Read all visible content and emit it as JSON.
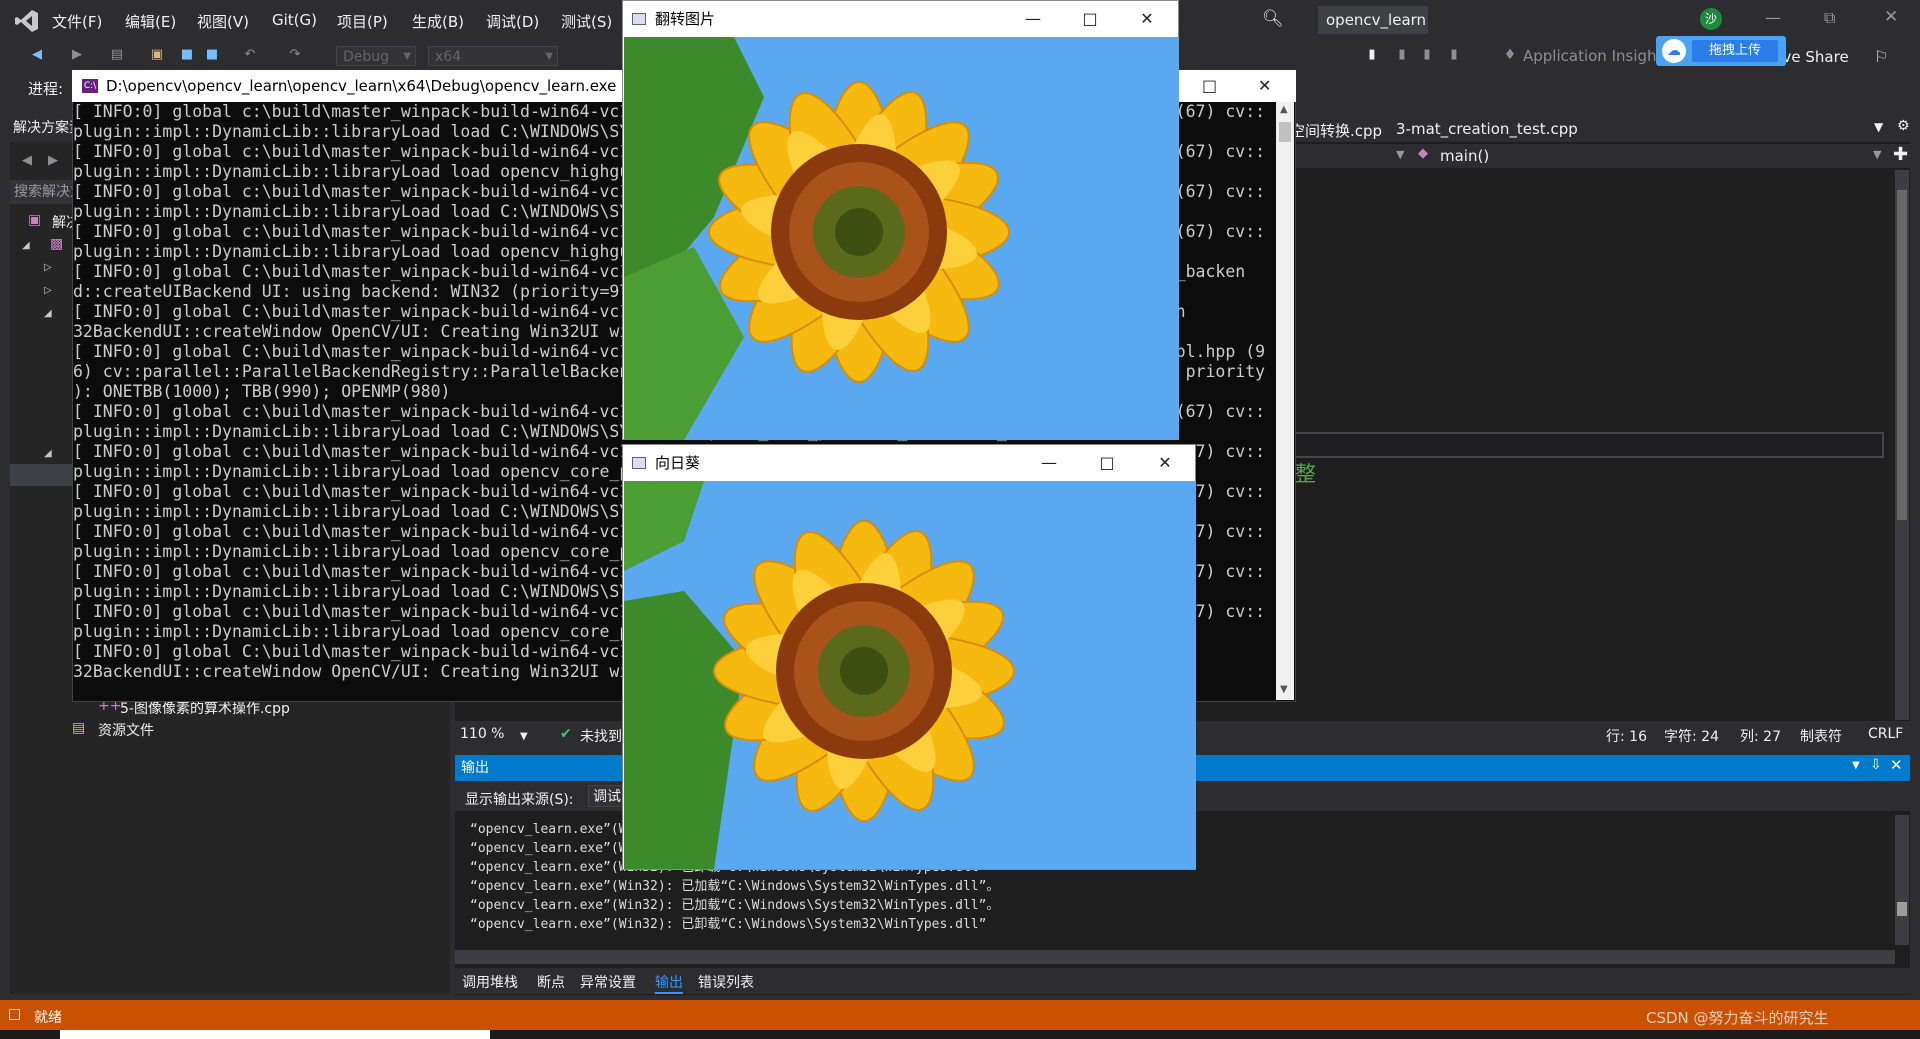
{
  "menu": {
    "items": [
      "文件(F)",
      "编辑(E)",
      "视图(V)",
      "Git(G)",
      "项目(P)",
      "生成(B)",
      "调试(D)",
      "测试(S)"
    ],
    "project_name": "opencv_learn",
    "live_share": "Live Share",
    "app_insights": "Application Insights",
    "baidu_upload": "拖拽上传",
    "user_initial": "沙"
  },
  "toolbar": {
    "config": "Debug",
    "platform": "x64",
    "progress_label": "进程:"
  },
  "solution": {
    "title": "解决方案资源管理器",
    "search_placeholder": "搜索解决方案资源管理器(Ctrl+;)",
    "root_label": "解决方案",
    "file_item": "5-图像像素的算术操作.cpp",
    "resource_folder": "资源文件"
  },
  "editor": {
    "tabs": [
      "4-图像色彩空间转换.cpp",
      "3-mat_creation_test.cpp"
    ],
    "function": "main()",
    "visible_chars": "整",
    "zoom": "110 %",
    "issues": "未找到相关问题",
    "line": "行: 16",
    "char": "字符: 24",
    "col": "列: 27",
    "tabs_mode": "制表符",
    "eol": "CRLF"
  },
  "output": {
    "title": "输出",
    "source_label": "显示输出来源(S):",
    "source_value": "调试",
    "lines": [
      "“opencv_learn.exe”(Win32): 已加载“C:\\Windows\\System32\\WinTypes.dll”。",
      "“opencv_learn.exe”(Win32): 已加载“C:\\Windows\\System32\\WinTypes.dll”。",
      "“opencv_learn.exe”(Win32): 已卸载“C:\\Windows\\System32\\WinTypes.dll”",
      "“opencv_learn.exe”(Win32): 已加载“C:\\Windows\\System32\\WinTypes.dll”。",
      "“opencv_learn.exe”(Win32): 已加载“C:\\Windows\\System32\\WinTypes.dll”。",
      "“opencv_learn.exe”(Win32): 已卸载“C:\\Windows\\System32\\WinTypes.dll”"
    ],
    "tabs": [
      "调用堆栈",
      "断点",
      "异常设置",
      "输出",
      "错误列表"
    ]
  },
  "statusbar": {
    "ready": "就绪",
    "watermark": "CSDN @努力奋斗的研究生"
  },
  "console": {
    "title": "D:\\opencv\\opencv_learn\\opencv_learn\\x64\\Debug\\opencv_learn.exe",
    "lines": [
      "[ INFO:0] global c:\\build\\master_winpack-build-win64-vc15\\opencv\\modules\\core\\src\\utils\\plugin_loader.impl.hpp (67) cv::",
      "plugin::impl::DynamicLib::libraryLoad load C:\\WINDOWS\\SYSTEM32\\opencv_highgui_msmf453_64d.dll => FAILED",
      "[ INFO:0] global c:\\build\\master_winpack-build-win64-vc15\\opencv\\modules\\core\\src\\utils\\plugin_loader.impl.hpp (67) cv::",
      "plugin::impl::DynamicLib::libraryLoad load opencv_highgui_msmf453_64d.dll => FAILED",
      "[ INFO:0] global c:\\build\\master_winpack-build-win64-vc15\\opencv\\modules\\core\\src\\utils\\plugin_loader.impl.hpp (67) cv::",
      "plugin::impl::DynamicLib::libraryLoad load C:\\WINDOWS\\SYSTEM32\\opencv_highgui_gtk453_64d.dll => FAILED",
      "[ INFO:0] global c:\\build\\master_winpack-build-win64-vc15\\opencv\\modules\\core\\src\\utils\\plugin_loader.impl.hpp (67) cv::",
      "plugin::impl::DynamicLib::libraryLoad load opencv_highgui_gtk453_64d.dll => FAILED",
      "[ INFO:0] global C:\\build\\master_winpack-build-win64-vc15\\opencv\\modules\\highgui\\src\\registry.impl.hpp  highgui_backen",
      "d::createUIBackend UI: using backend: WIN32 (priority=970)",
      "[ INFO:0] global C:\\build\\master_winpack-build-win64-vc15\\opencv\\modules\\highgui\\src\\window_w32.cpp    impl::Win",
      "32BackendUI::createWindow OpenCV/UI: Creating Win32UI window: 向日葵 (1)",
      "[ INFO:0] global C:\\build\\master_winpack-build-win64-vc15\\opencv\\modules\\core\\src\\parallel\\registry_parallel.impl.hpp (9",
      "6) cv::parallel::ParallelBackendRegistry::ParallelBackendRegistry core(parallel): Enabled backends(3, sorted by priority",
      "): ONETBB(1000); TBB(990); OPENMP(980)",
      "[ INFO:0] global c:\\build\\master_winpack-build-win64-vc15\\opencv\\modules\\core\\src\\utils\\plugin_loader.impl.hpp (67) cv::",
      "plugin::impl::DynamicLib::libraryLoad load C:\\WINDOWS\\SYSTEM32\\opencv_core_parallel_onetbb453_64d.dll => FAILED",
      "[ INFO:0] global c:\\build\\master_winpack-build-win64-vc15\\opencv\\modules\\core\\src\\utils\\plugin_loader.impl.hpp (67) cv::",
      "plugin::impl::DynamicLib::libraryLoad load opencv_core_parallel_onetbb453_64d.dll => FAILED",
      "[ INFO:0] global c:\\build\\master_winpack-build-win64-vc15\\opencv\\modules\\core\\src\\utils\\plugin_loader.impl.hpp (67) cv::",
      "plugin::impl::DynamicLib::libraryLoad load C:\\WINDOWS\\SYSTEM32\\opencv_core_parallel_tbb453_64d.dll => FAILED",
      "[ INFO:0] global c:\\build\\master_winpack-build-win64-vc15\\opencv\\modules\\core\\src\\utils\\plugin_loader.impl.hpp (67) cv::",
      "plugin::impl::DynamicLib::libraryLoad load opencv_core_parallel_tbb453_64d.dll => FAILED",
      "[ INFO:0] global c:\\build\\master_winpack-build-win64-vc15\\opencv\\modules\\core\\src\\utils\\plugin_loader.impl.hpp (67) cv::",
      "plugin::impl::DynamicLib::libraryLoad load C:\\WINDOWS\\SYSTEM32\\opencv_core_parallel_openmp453_64d.dll => FAILED",
      "[ INFO:0] global c:\\build\\master_winpack-build-win64-vc15\\opencv\\modules\\core\\src\\utils\\plugin_loader.impl.hpp (67) cv::",
      "plugin::impl::DynamicLib::libraryLoad load opencv_core_parallel_openmp453_64d.dll => FAILED",
      "[ INFO:0] global C:\\build\\master_winpack-build-win64-vc15\\opencv\\modules\\highgui\\src\\window_w32.cpp    impl::Win",
      "32BackendUI::createWindow OpenCV/UI: Creating Win32UI window: 翻转图片 (1)"
    ]
  },
  "windows": {
    "flip_title": "翻转图片",
    "sunflower_title": "向日葵"
  },
  "colors": {
    "vs_bg": "#2d2d30",
    "accent": "#007acc",
    "status": "#ca5100",
    "sky": "#5aa9f0"
  }
}
